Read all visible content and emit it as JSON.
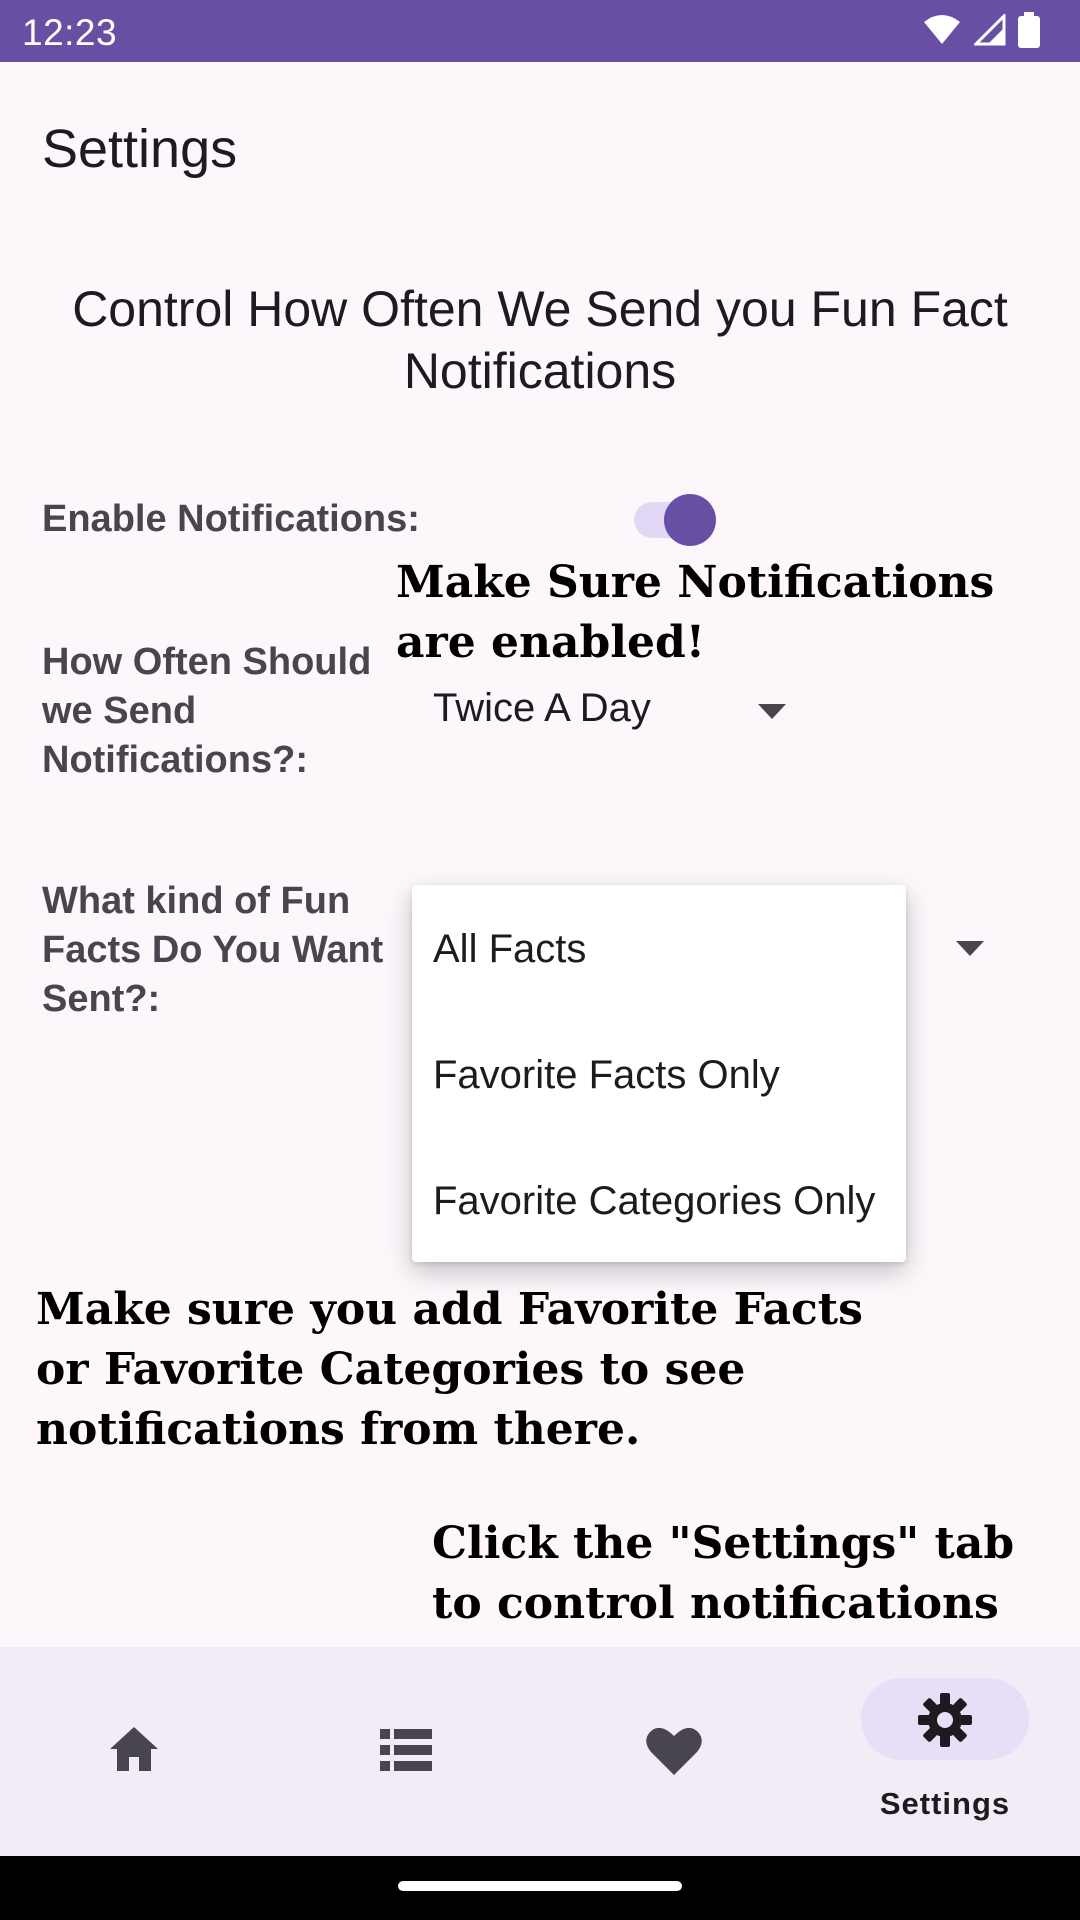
{
  "status_bar": {
    "time": "12:23",
    "icons": [
      "wifi-icon",
      "signal-icon",
      "battery-icon"
    ]
  },
  "app_bar": {
    "title": "Settings"
  },
  "heading": "Control How Often We Send you Fun Fact Notifications",
  "notifications": {
    "label": "Enable Notifications:",
    "enabled": true,
    "callout": "Make Sure Notifications are enabled!"
  },
  "frequency": {
    "label": "How Often Should we Send Notifications?:",
    "selected": "Twice A Day"
  },
  "fact_kind": {
    "label": "What kind of Fun Facts Do You Want Sent?:",
    "options": [
      "All Facts",
      "Favorite Facts Only",
      "Favorite Categories Only"
    ]
  },
  "favorites_note": "Make sure you add Favorite Facts or Favorite Categories to see notifications from there.",
  "settings_tab_note": "Click the \"Settings\" tab to control notifications",
  "bottom_nav": {
    "items": [
      {
        "icon": "home-icon",
        "label": ""
      },
      {
        "icon": "list-icon",
        "label": ""
      },
      {
        "icon": "heart-icon",
        "label": ""
      },
      {
        "icon": "gear-icon",
        "label": "Settings",
        "selected": true
      }
    ]
  },
  "colors": {
    "primary": "#6750a4",
    "surface": "#fdf7fc",
    "nav_bg": "#f2ecf6",
    "pill": "#e8def8"
  }
}
